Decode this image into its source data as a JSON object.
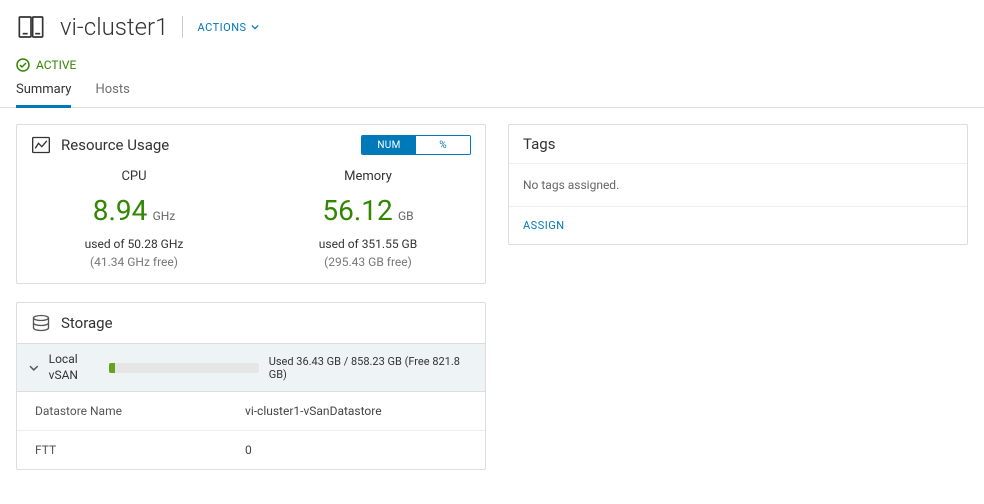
{
  "header": {
    "title": "vi-cluster1",
    "actions_label": "ACTIONS"
  },
  "status": {
    "label": "ACTIVE"
  },
  "tabs": {
    "summary": "Summary",
    "hosts": "Hosts"
  },
  "resource_card": {
    "title": "Resource Usage",
    "toggle_num": "NUM",
    "toggle_pct": "%",
    "cpu": {
      "label": "CPU",
      "value": "8.94",
      "unit": "GHz",
      "used_of": "used of 50.28 GHz",
      "free": "(41.34 GHz free)"
    },
    "memory": {
      "label": "Memory",
      "value": "56.12",
      "unit": "GB",
      "used_of": "used of 351.55 GB",
      "free": "(295.43 GB free)"
    }
  },
  "storage_card": {
    "title": "Storage",
    "group_label": "Local vSAN",
    "usage_text": "Used 36.43 GB / 858.23 GB (Free 821.8 GB)",
    "fill_pct": 4,
    "rows": {
      "ds_k": "Datastore Name",
      "ds_v": "vi-cluster1-vSanDatastore",
      "ftt_k": "FTT",
      "ftt_v": "0"
    }
  },
  "tags_card": {
    "title": "Tags",
    "empty": "No tags assigned.",
    "assign": "ASSIGN"
  }
}
